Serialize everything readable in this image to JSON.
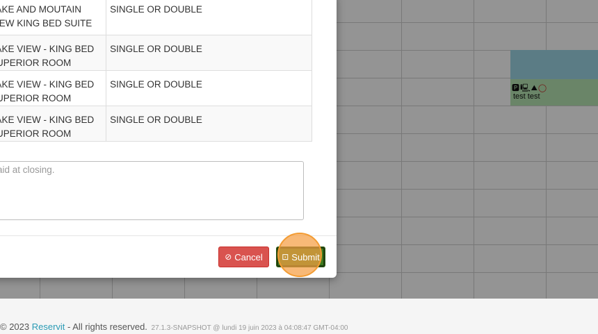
{
  "booking": {
    "icons": "🅿🖳⛰",
    "circle": "◯",
    "guest_name": "test test"
  },
  "rooms_table": {
    "rows": [
      {
        "room": "LAKE AND MOUTAIN VIEW KING BED SUITE",
        "type": "SINGLE OR DOUBLE"
      },
      {
        "room": "LAKE VIEW - KING BED SUPERIOR ROOM",
        "type": "SINGLE OR DOUBLE"
      },
      {
        "room": "LAKE VIEW - KING BED SUPERIOR ROOM",
        "type": "SINGLE OR DOUBLE"
      },
      {
        "room": "LAKE VIEW - KING BED SUPERIOR ROOM",
        "type": "SINGLE OR DOUBLE"
      }
    ]
  },
  "notes": {
    "placeholder": "Paid at closing."
  },
  "buttons": {
    "cancel_label": "Cancel",
    "submit_label": "Submit"
  },
  "footer": {
    "copyright_prefix": "© 2023 ",
    "brand": "Reservit",
    "rights": " - All rights reserved.",
    "version": "27.1.3-SNAPSHOT @ lundi 19 juin 2023 à 04:08:47 GMT-04:00"
  },
  "colors": {
    "cancel": "#d9534f",
    "submit": "#3d7a1e",
    "brand_link": "#2a9bb5",
    "highlight": "#f59e42"
  }
}
